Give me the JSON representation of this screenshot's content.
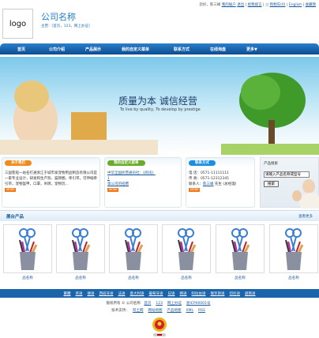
{
  "top_bar": {
    "greeting": "您好，陈三峰",
    "account": "我的账户",
    "logout": "退出",
    "message": "给我留言",
    "cart": "购物车(0)",
    "english": "English",
    "favorite": "收藏我"
  },
  "header": {
    "logo": "logo",
    "company_name": "公司名称",
    "business": "主营：[首页，123，网上办证]"
  },
  "nav": [
    "首页",
    "公司介绍",
    "产品展示",
    "我的自定义菜单",
    "联系方式",
    "在线询盘",
    "更多▼"
  ],
  "banner": {
    "slogan": "质量为本  诚信经营",
    "slogan_en": "To live by quality, To develop by prestige"
  },
  "about": {
    "title": "关于我们",
    "text": "三国客船一站名打通浙江于城市发宠物用品制造有限公司是一家专业设计，研发和生产狗、猫牌圈，牵引带，可伸缩牵引带，宠物盔甲，口罩，吊牌，宠物玩...",
    "more": "MORE"
  },
  "custom": {
    "title": "我的自定义菜单",
    "links": [
      "中华全国民营通讯社：《商讯》",
      "1",
      "第公司的招聘"
    ],
    "more": "MORE"
  },
  "contact": {
    "title": "联系方式",
    "phone_label": "电    话：",
    "phone": "0571-11111111",
    "fax_label": "传    真：",
    "fax": "0571-12312345",
    "person_label": "联系人：",
    "person": "陈三峰",
    "person_suffix": " 先生 (总经理)",
    "more": "MORE"
  },
  "search": {
    "title": "产品搜索",
    "placeholder": "请输入产品名称或型号",
    "button": "搜索"
  },
  "products": {
    "title": "展台产品",
    "more": "查看更多",
    "items": [
      "品名称",
      "品名称",
      "品名称",
      "品名称",
      "品名称",
      "品名称"
    ]
  },
  "footer": {
    "languages": [
      "繁體",
      "英语",
      "德语",
      "西班牙语",
      "法语",
      "意大利语",
      "葡萄牙语",
      "日语",
      "韩语",
      "阿拉伯语",
      "俄罗斯语",
      "印尼语",
      "越南语"
    ],
    "copyright": "版权所有 © 公司名称",
    "links1": [
      "首页",
      "123",
      "网上办证",
      "浙ICP00001号"
    ],
    "support": "技术支持：",
    "links2": [
      "阿土网",
      "网站地图",
      "产品地图",
      "XML",
      "RSS"
    ]
  }
}
